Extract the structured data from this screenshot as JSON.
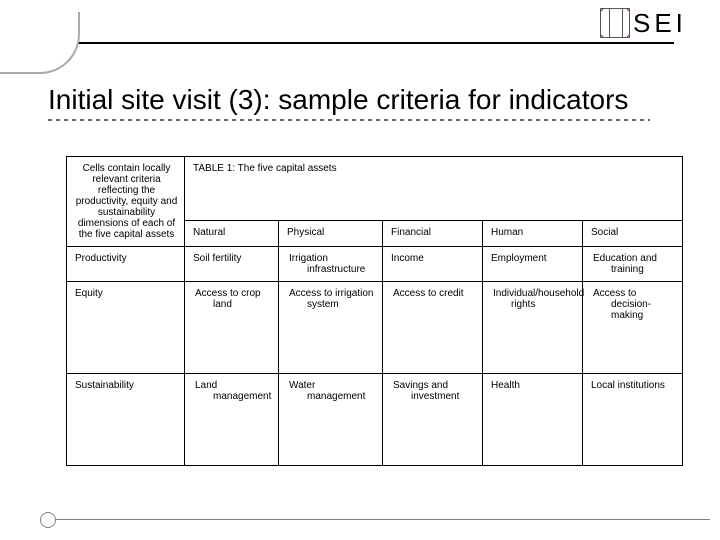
{
  "logo": {
    "text": "SEI"
  },
  "title": "Initial site visit (3): sample criteria for indicators",
  "table": {
    "desc": "Cells contain locally relevant criteria reflecting the productivity, equity and sustainability dimensions of each of the five capital assets",
    "caption": "TABLE 1: The five capital assets",
    "col_headers": [
      "Natural",
      "Physical",
      "Financial",
      "Human",
      "Social"
    ],
    "row_headers": [
      "Productivity",
      "Equity",
      "Sustainability"
    ],
    "rows": [
      [
        "Soil fertility",
        "Irrigation infrastructure",
        "Income",
        "Employment",
        "Education and training"
      ],
      [
        "Access to crop land",
        "Access to irrigation system",
        "Access to credit",
        "Individual/household rights",
        "Access to decision-making"
      ],
      [
        "Land management",
        "Water management",
        "Savings and investment",
        "Health",
        "Local institutions"
      ]
    ]
  },
  "chart_data": {
    "type": "table",
    "title": "TABLE 1: The five capital assets",
    "columns": [
      "",
      "Natural",
      "Physical",
      "Financial",
      "Human",
      "Social"
    ],
    "rows": [
      [
        "Productivity",
        "Soil fertility",
        "Irrigation infrastructure",
        "Income",
        "Employment",
        "Education and training"
      ],
      [
        "Equity",
        "Access to crop land",
        "Access to irrigation system",
        "Access to credit",
        "Individual/household rights",
        "Access to decision-making"
      ],
      [
        "Sustainability",
        "Land management",
        "Water management",
        "Savings and investment",
        "Health",
        "Local institutions"
      ]
    ]
  }
}
